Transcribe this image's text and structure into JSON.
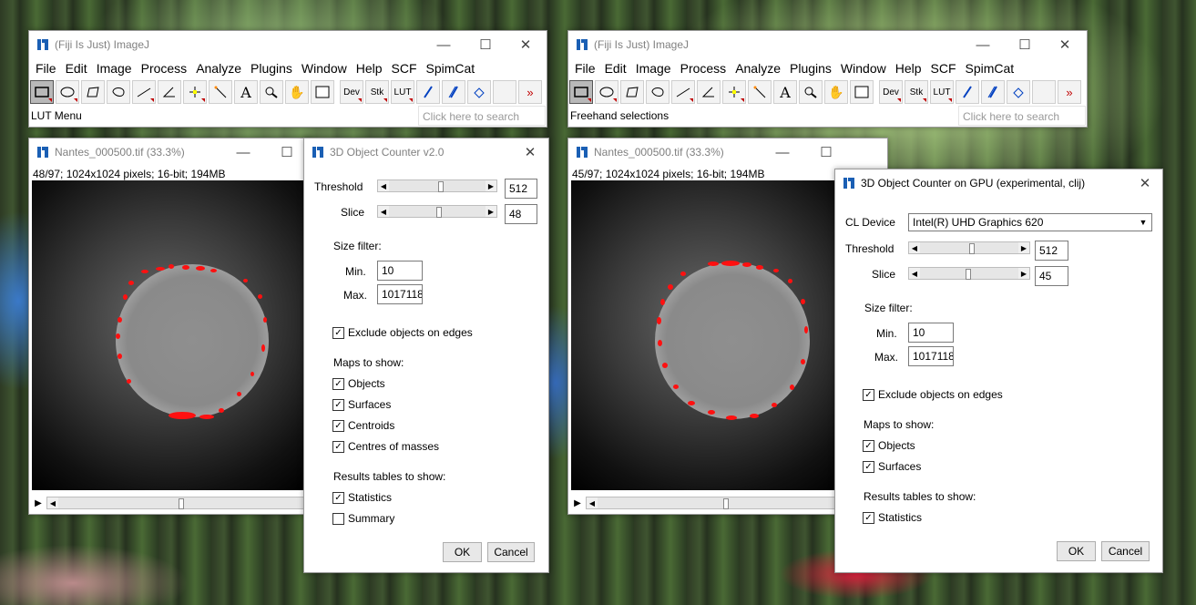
{
  "colors": {
    "accent_red": "#ff1010",
    "ij_icon_blue": "#1a5fb4"
  },
  "left": {
    "fiji": {
      "title": "(Fiji Is Just) ImageJ",
      "menu": [
        "File",
        "Edit",
        "Image",
        "Process",
        "Analyze",
        "Plugins",
        "Window",
        "Help",
        "SCF",
        "SpimCat"
      ],
      "tools": {
        "dev": "Dev",
        "stk": "Stk",
        "lut": "LUT",
        "more": "»"
      },
      "status": "LUT Menu",
      "search_placeholder": "Click here to search"
    },
    "image": {
      "title": "Nantes_000500.tif (33.3%)",
      "info": "48/97; 1024x1024 pixels; 16-bit; 194MB"
    },
    "dialog": {
      "title": "3D Object Counter v2.0",
      "threshold_label": "Threshold",
      "threshold_value": "512",
      "slice_label": "Slice",
      "slice_value": "48",
      "size_filter": "Size filter:",
      "min_label": "Min.",
      "min_value": "10",
      "max_label": "Max.",
      "max_value": "1017118",
      "exclude": "Exclude objects on edges",
      "maps_header": "Maps to show:",
      "maps": [
        "Objects",
        "Surfaces",
        "Centroids",
        "Centres of masses"
      ],
      "results_header": "Results tables to show:",
      "results": [
        {
          "label": "Statistics",
          "checked": true
        },
        {
          "label": "Summary",
          "checked": false
        }
      ],
      "ok": "OK",
      "cancel": "Cancel"
    }
  },
  "right": {
    "fiji": {
      "title": "(Fiji Is Just) ImageJ",
      "menu": [
        "File",
        "Edit",
        "Image",
        "Process",
        "Analyze",
        "Plugins",
        "Window",
        "Help",
        "SCF",
        "SpimCat"
      ],
      "tools": {
        "dev": "Dev",
        "stk": "Stk",
        "lut": "LUT",
        "more": "»"
      },
      "status": "Freehand selections",
      "search_placeholder": "Click here to search"
    },
    "image": {
      "title": "Nantes_000500.tif (33.3%)",
      "info": "45/97; 1024x1024 pixels; 16-bit; 194MB"
    },
    "dialog": {
      "title": "3D Object Counter on GPU (experimental, clij)",
      "cl_device_label": "CL Device",
      "cl_device_value": "Intel(R) UHD Graphics 620",
      "threshold_label": "Threshold",
      "threshold_value": "512",
      "slice_label": "Slice",
      "slice_value": "45",
      "size_filter": "Size filter:",
      "min_label": "Min.",
      "min_value": "10",
      "max_label": "Max.",
      "max_value": "1017118",
      "exclude": "Exclude objects on edges",
      "maps_header": "Maps to show:",
      "maps": [
        "Objects",
        "Surfaces"
      ],
      "results_header": "Results tables to show:",
      "results": [
        {
          "label": "Statistics",
          "checked": true
        }
      ],
      "ok": "OK",
      "cancel": "Cancel"
    }
  }
}
